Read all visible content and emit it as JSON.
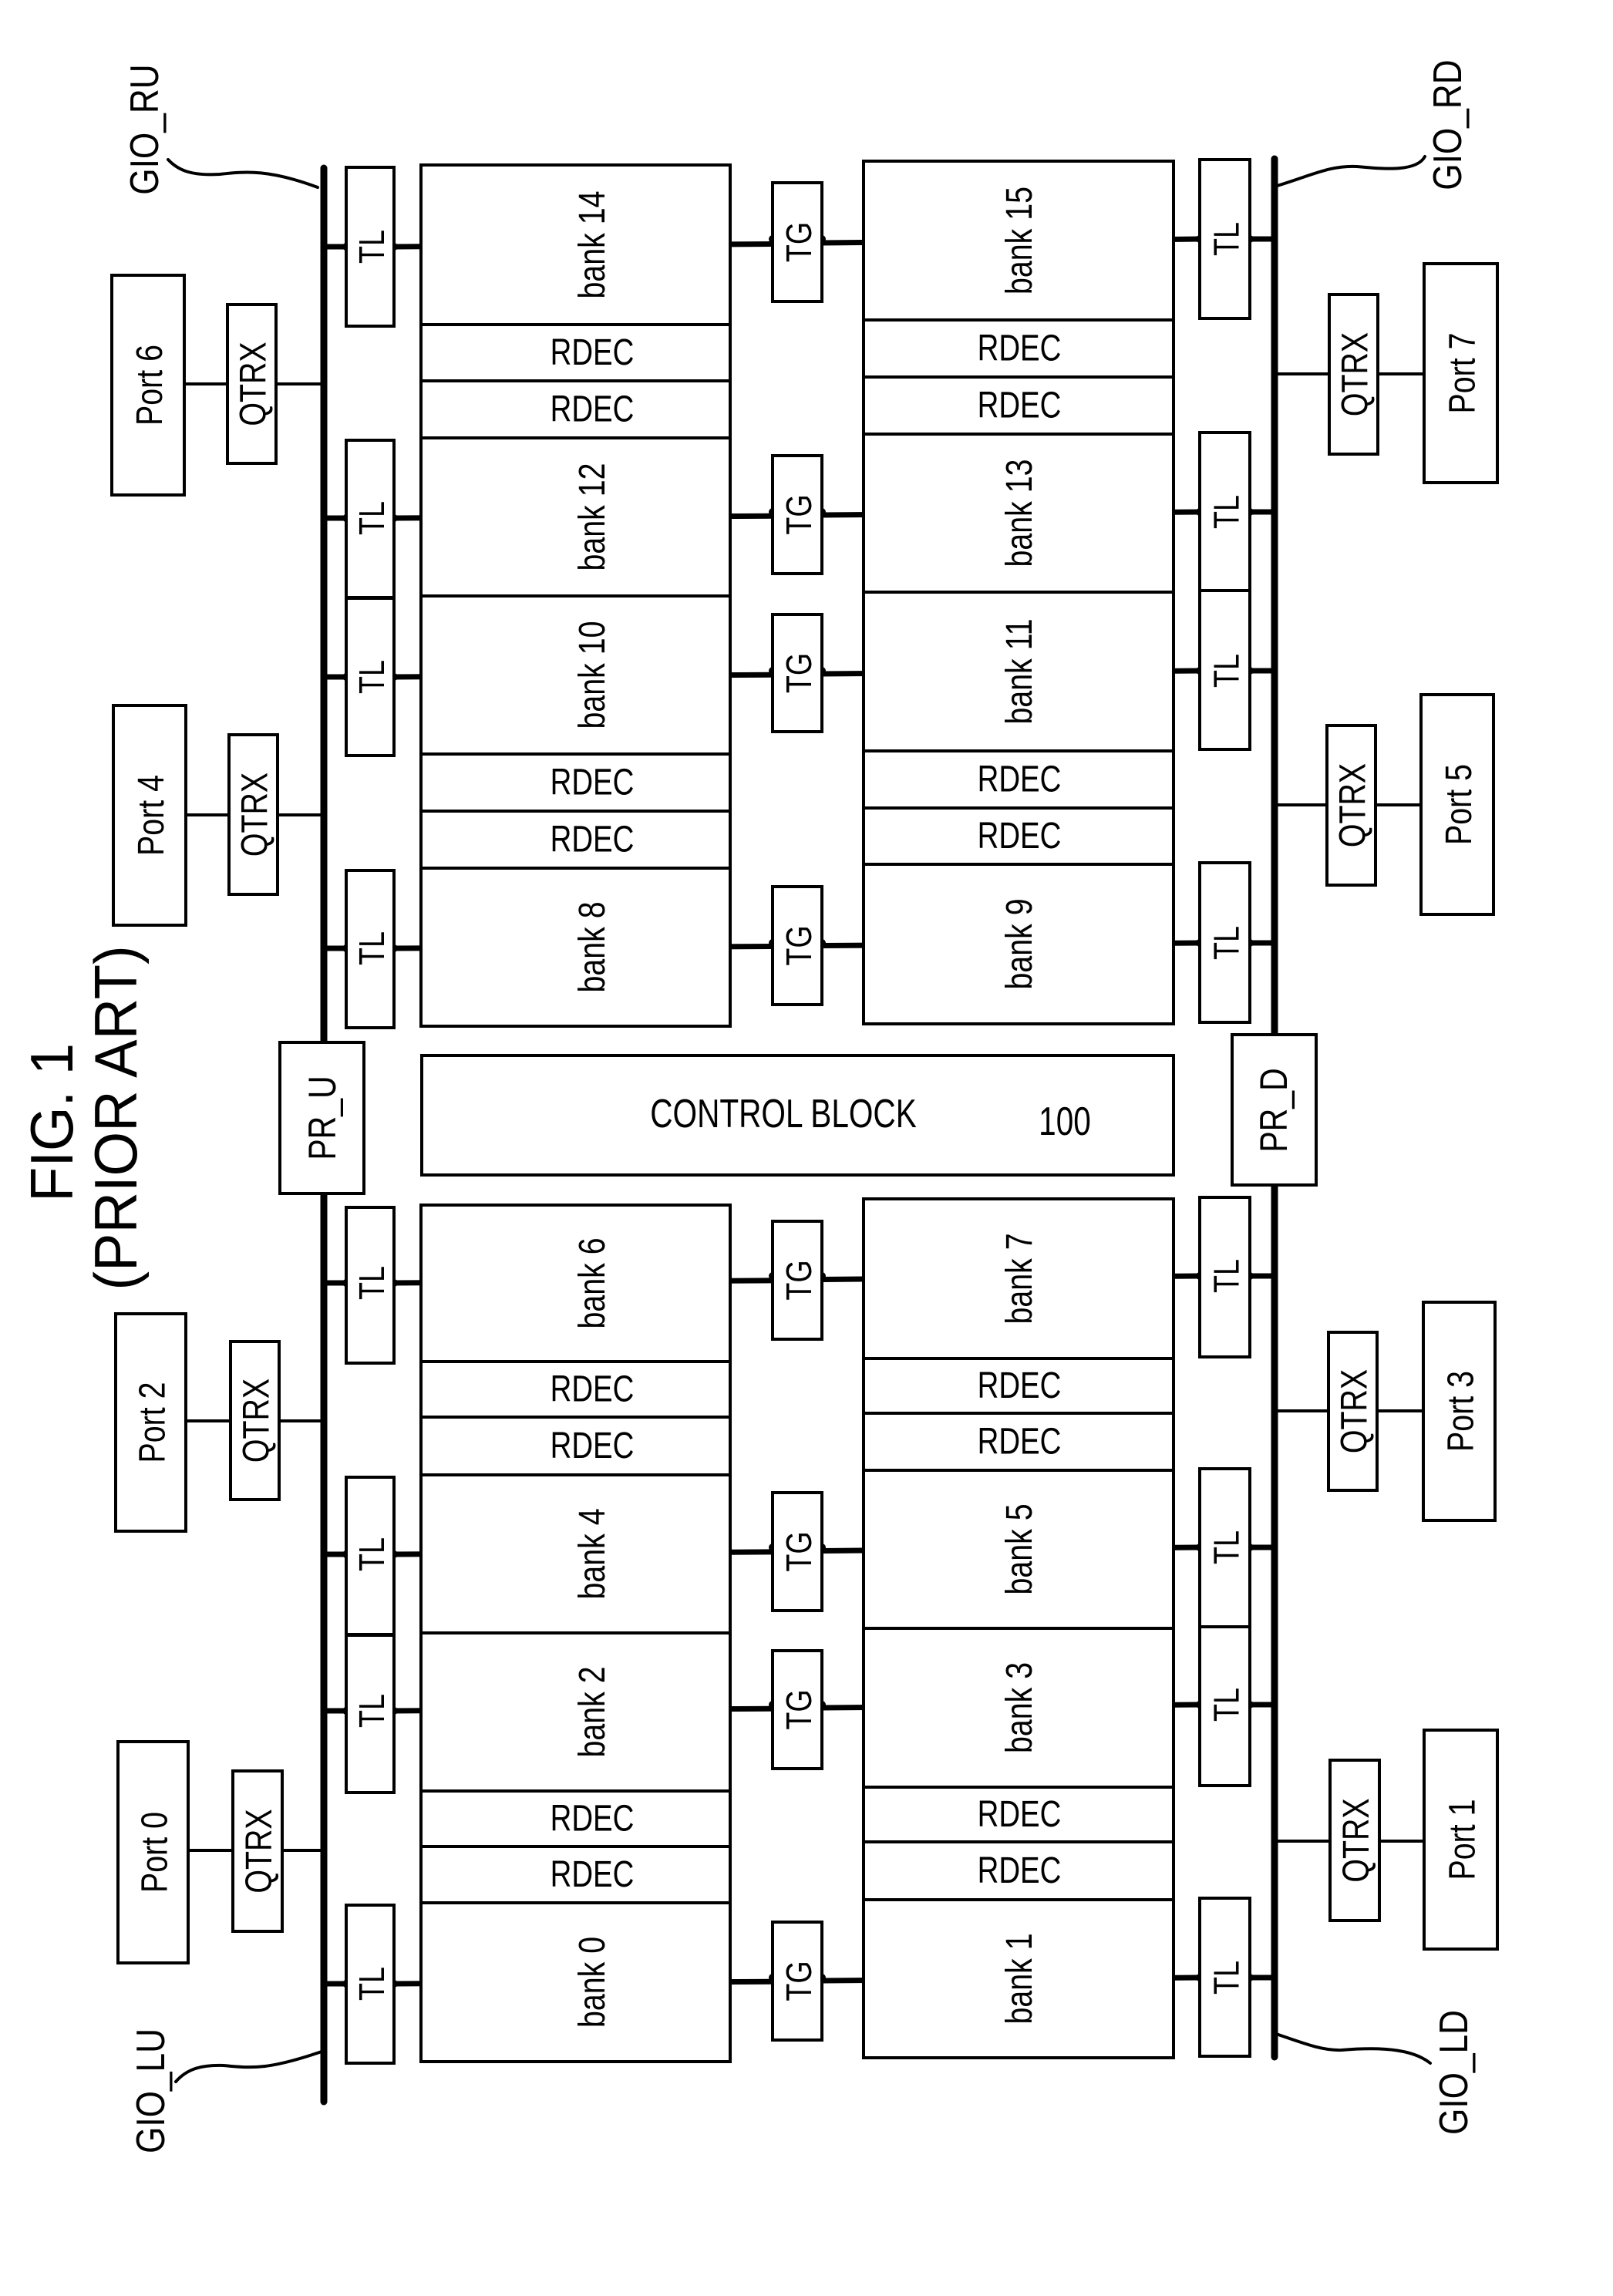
{
  "figure": {
    "title": "FIG. 1",
    "subtitle": "(PRIOR ART)"
  },
  "buses": {
    "upper_left": "GIO_RU",
    "upper_right": "GIO_RD",
    "lower_left": "GIO_LU",
    "lower_right": "GIO_LD"
  },
  "control_block": {
    "label": "CONTROL BLOCK",
    "reference": "100"
  },
  "pipe_registers": {
    "left": "PR_U",
    "right": "PR_D"
  },
  "ports": {
    "left": [
      "Port 6",
      "Port 4",
      "Port 2",
      "Port 0"
    ],
    "right": [
      "Port 7",
      "Port 5",
      "Port 3",
      "Port 1"
    ]
  },
  "transceiver_label": "QTRX",
  "transfer_latch_label": "TL",
  "transfer_gate_label": "TG",
  "row_decoder_label": "RDEC",
  "banks": {
    "left": [
      "bank 14",
      "bank 12",
      "bank 10",
      "bank 8",
      "bank 6",
      "bank 4",
      "bank 2",
      "bank 0"
    ],
    "right": [
      "bank 15",
      "bank 13",
      "bank 11",
      "bank 9",
      "bank 7",
      "bank 5",
      "bank 3",
      "bank 1"
    ]
  },
  "colors": {
    "ink": "#000000",
    "paper": "#ffffff"
  }
}
